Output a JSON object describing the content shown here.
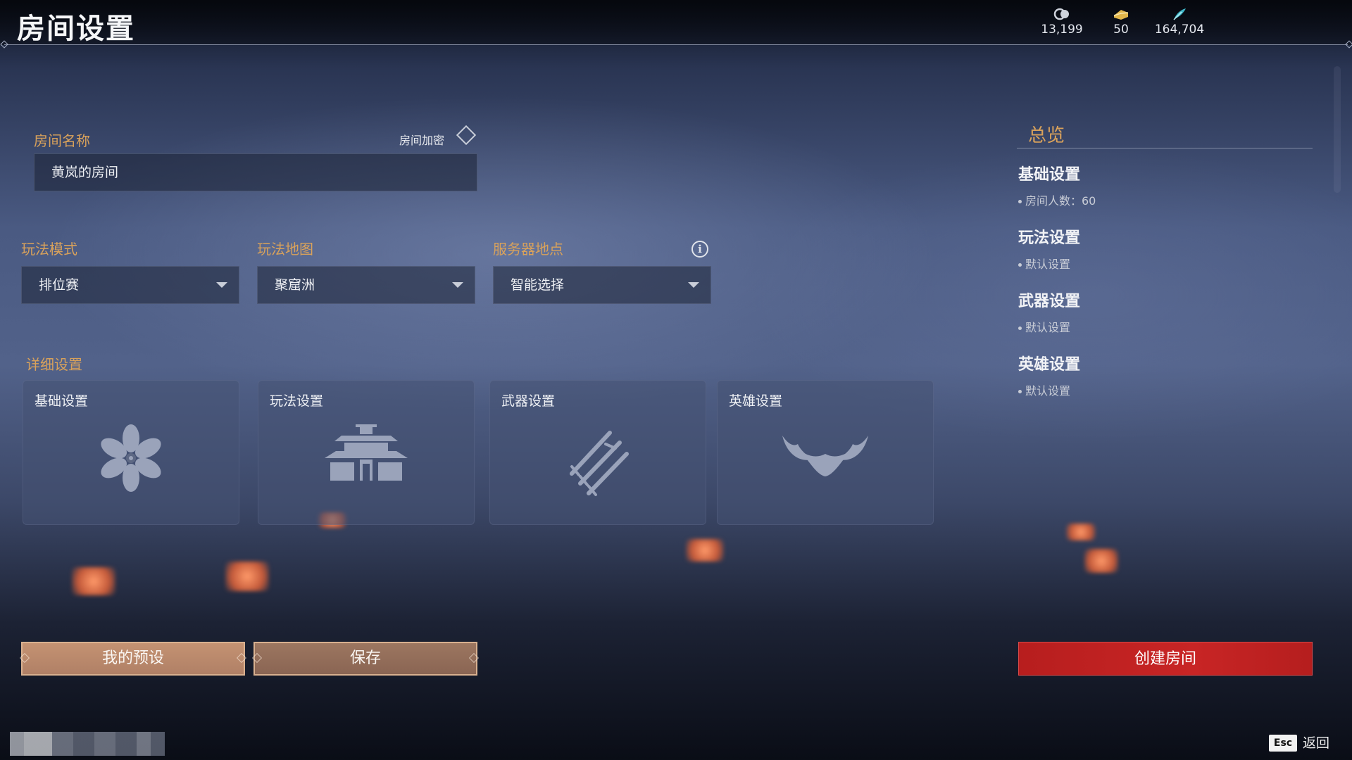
{
  "page": {
    "title": "房间设置"
  },
  "currency": [
    {
      "icon": "coin-icon",
      "value": "13,199"
    },
    {
      "icon": "gold-ingot-icon",
      "value": "50"
    },
    {
      "icon": "feather-icon",
      "value": "164,704"
    }
  ],
  "room": {
    "name_label": "房间名称",
    "name_value": "黄岚的房间",
    "encrypt_label": "房间加密"
  },
  "mode": {
    "mode_label": "玩法模式",
    "mode_value": "排位赛",
    "map_label": "玩法地图",
    "map_value": "聚窟洲",
    "server_label": "服务器地点",
    "server_value": "智能选择"
  },
  "details": {
    "label": "详细设置",
    "cards": [
      {
        "label": "基础设置",
        "icon": "flower-icon"
      },
      {
        "label": "玩法设置",
        "icon": "pagoda-icon"
      },
      {
        "label": "武器设置",
        "icon": "swords-icon"
      },
      {
        "label": "英雄设置",
        "icon": "demon-mask-icon"
      }
    ]
  },
  "overview": {
    "title": "总览",
    "sections": [
      {
        "heading": "基础设置",
        "detail": "房间人数：60"
      },
      {
        "heading": "玩法设置",
        "detail": "默认设置"
      },
      {
        "heading": "武器设置",
        "detail": "默认设置"
      },
      {
        "heading": "英雄设置",
        "detail": "默认设置"
      }
    ]
  },
  "buttons": {
    "presets": "我的预设",
    "save": "保存",
    "create": "创建房间"
  },
  "footer": {
    "esc_key": "Esc",
    "esc_label": "返回"
  },
  "colors": {
    "accent_gold": "#d9a25b",
    "create_red": "#c82525",
    "button_tan": "#b58569"
  }
}
